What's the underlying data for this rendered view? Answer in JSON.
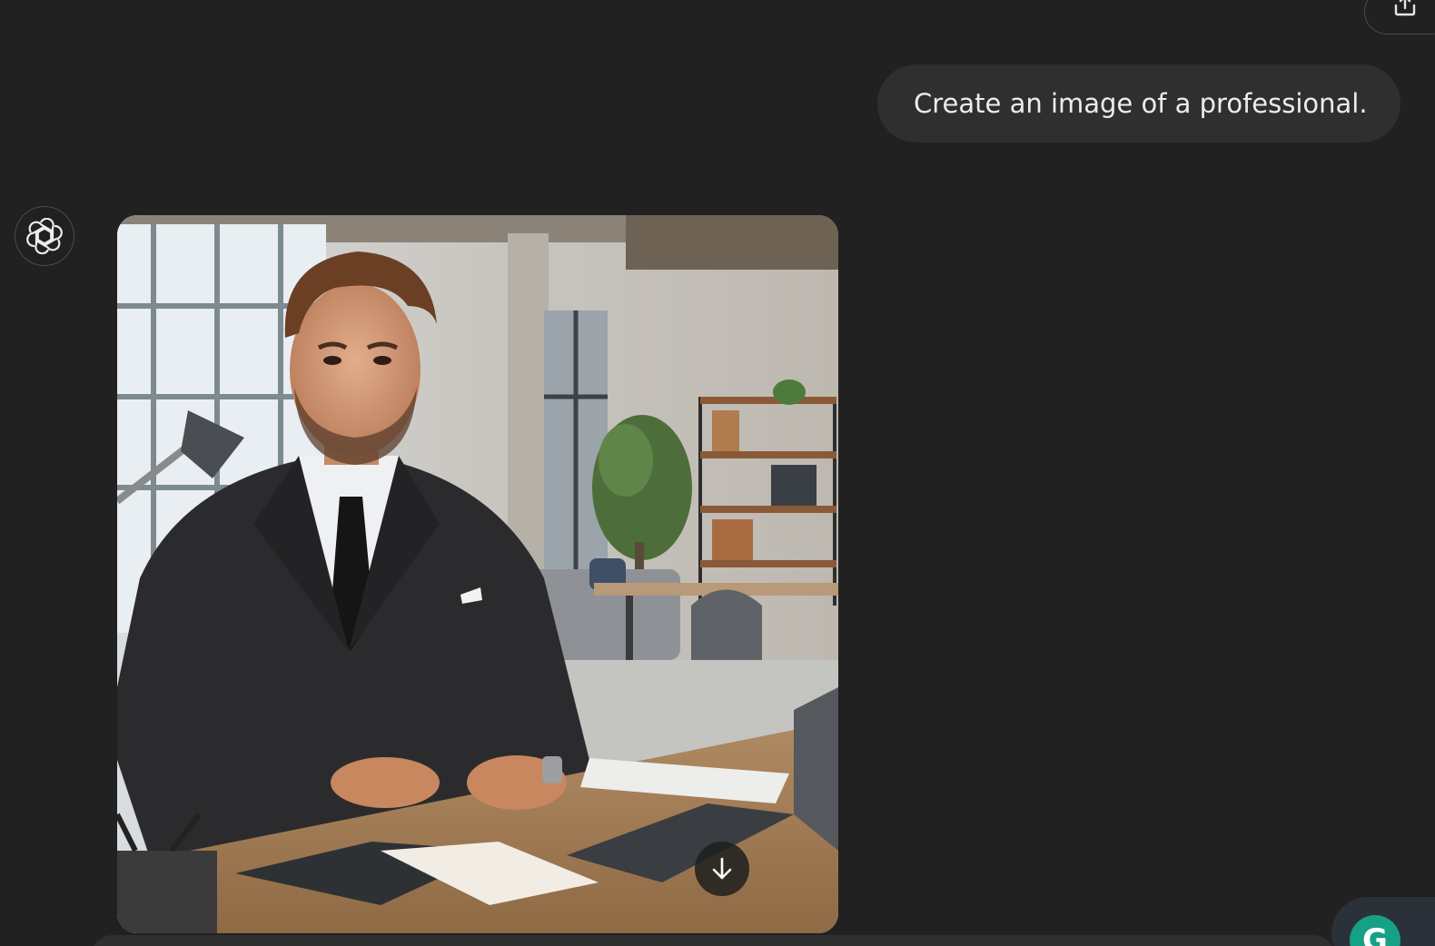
{
  "header": {
    "share_icon": "share-icon"
  },
  "conversation": {
    "user_message": "Create an image of a professional.",
    "assistant_avatar_icon": "openai-logo-icon",
    "generated_image_icon": "photo-of-businessman-in-office",
    "download_icon": "arrow-down-icon"
  },
  "grammarly": {
    "icon_letter": "G",
    "icon": "grammarly-icon"
  },
  "colors": {
    "background": "#212121",
    "bubble": "#2f2f2f",
    "text": "#ececec",
    "grammarly": "#16a085"
  }
}
